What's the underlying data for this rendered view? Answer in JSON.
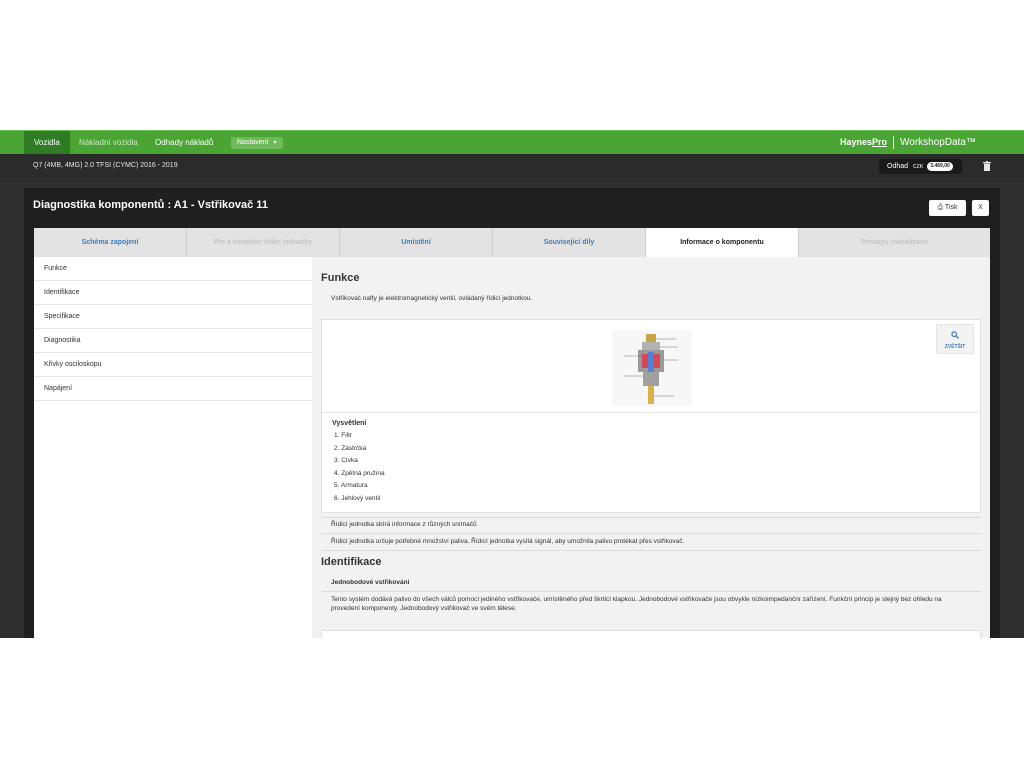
{
  "navbar": {
    "tabs": [
      "Vozidla",
      "Nákladní vozidla",
      "Odhady nákladů"
    ],
    "settings_label": "Nastavení",
    "brand_haynes": "Haynes",
    "brand_pro": "Pro",
    "brand_product": "WorkshopData™"
  },
  "vehicle": {
    "name": "Q7 (4MB, 4MG) 2.0 TFSI (CYMC) 2016 - 2019",
    "estimate_label": "Odhad",
    "currency": "CZK",
    "amount": "3.469,00"
  },
  "modal": {
    "title": "Diagnostika komponentů : A1 - Vstřikovač 11",
    "print_label": "Tisk",
    "close_label": "X",
    "tabs": [
      "Schéma zapojení",
      "Pin a konektor řídicí jednotky",
      "Umístění",
      "Související díly",
      "Informace o komponentu",
      "Postupy inicializace"
    ]
  },
  "left_nav": [
    "Funkce",
    "Identifikace",
    "Specifikace",
    "Diagnostika",
    "Křivky osciloskopu",
    "Napájení"
  ],
  "content": {
    "function_heading": "Funkce",
    "function_text": "Vstřikovač nafty je elektromagnetický ventil, ovládaný řídicí jednotkou.",
    "zoom_label": "ZVĚTŠIT",
    "legend_title": "Vysvětlení",
    "legend_items": [
      "1.  Filtr",
      "2.  Zástrčka",
      "3.  Cívka",
      "4.  Zpětná pružina",
      "5.  Armatura",
      "6.  Jehlový ventil"
    ],
    "note1": "Řídicí jednotka sbírá informace z různých snímačů",
    "note2": "Řídicí jednotka určuje potřebné množství paliva. Řídicí jednotka vysílá signál, aby umožnila palivu protékat přes vstřikovač.",
    "ident_heading": "Identifikace",
    "ident_subheading": "Jednobodové vstřikování",
    "ident_text_line1": "Tento systém dodává palivo do všech válců pomocí jediného vstřikovače, umístěného před škrticí klapkou. Jednobodové vstřikovače jsou obvykle nízkoimpedanční zařízení. Funkční princip je stejný bez ohledu na",
    "ident_text_line2": "provedení komponenty. Jednobodový vstřikovač ve svém tělese."
  },
  "colors": {
    "navbar": "#4aa535",
    "accent_link": "#3d7fc1",
    "dark_bar": "#2b2b2b"
  }
}
